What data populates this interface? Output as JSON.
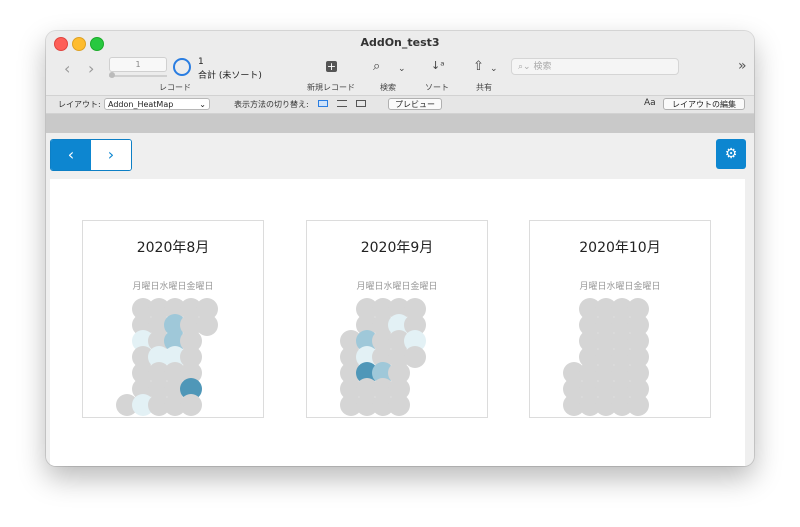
{
  "window": {
    "title": "AddOn_test3"
  },
  "toolbar": {
    "record_field_value": "1",
    "record_count": "1",
    "record_status": "合計 (未ソート)",
    "record_label": "レコード",
    "new_record_label": "新規レコード",
    "find_label": "検索",
    "sort_label": "ソート",
    "share_label": "共有",
    "search_placeholder": "検索"
  },
  "layoutbar": {
    "layout_label": "レイアウト:",
    "layout_value": "Addon_HeatMap",
    "view_switch_label": "表示方法の切り替え:",
    "preview_label": "プレビュー",
    "font_glyph": "Aa",
    "edit_layout_label": "レイアウトの編集"
  },
  "colors": {
    "accent": "#0d86d0",
    "empty": "#d5d5d5",
    "level1": "#e3f1f5",
    "level2": "#9fc8d9",
    "level3": "#4f97b8"
  },
  "cards": [
    {
      "title": "2020年8月",
      "weekdays": "月曜日水曜日金曜日",
      "cells": [
        [
          0,
          6,
          0
        ],
        [
          1,
          0,
          0
        ],
        [
          1,
          1,
          0
        ],
        [
          1,
          2,
          1
        ],
        [
          1,
          3,
          0
        ],
        [
          1,
          4,
          0
        ],
        [
          1,
          5,
          0
        ],
        [
          1,
          6,
          1
        ],
        [
          2,
          0,
          0
        ],
        [
          2,
          1,
          0
        ],
        [
          2,
          2,
          0
        ],
        [
          2,
          3,
          1
        ],
        [
          2,
          4,
          0
        ],
        [
          2,
          5,
          0
        ],
        [
          2,
          6,
          0
        ],
        [
          3,
          0,
          0
        ],
        [
          3,
          1,
          2
        ],
        [
          3,
          2,
          2
        ],
        [
          3,
          3,
          1
        ],
        [
          3,
          4,
          0
        ],
        [
          3,
          5,
          0
        ],
        [
          3,
          6,
          0
        ],
        [
          4,
          0,
          0
        ],
        [
          4,
          1,
          0
        ],
        [
          4,
          2,
          0
        ],
        [
          4,
          3,
          0
        ],
        [
          4,
          4,
          0
        ],
        [
          4,
          5,
          3
        ],
        [
          4,
          6,
          0
        ],
        [
          5,
          0,
          0
        ],
        [
          5,
          1,
          0
        ]
      ]
    },
    {
      "title": "2020年9月",
      "weekdays": "月曜日水曜日金曜日",
      "cells": [
        [
          0,
          2,
          0
        ],
        [
          0,
          3,
          0
        ],
        [
          0,
          4,
          0
        ],
        [
          0,
          5,
          0
        ],
        [
          0,
          6,
          0
        ],
        [
          1,
          0,
          0
        ],
        [
          1,
          1,
          0
        ],
        [
          1,
          2,
          2
        ],
        [
          1,
          3,
          1
        ],
        [
          1,
          4,
          3
        ],
        [
          1,
          5,
          0
        ],
        [
          1,
          6,
          0
        ],
        [
          2,
          0,
          0
        ],
        [
          2,
          1,
          0
        ],
        [
          2,
          2,
          0
        ],
        [
          2,
          3,
          0
        ],
        [
          2,
          4,
          2
        ],
        [
          2,
          5,
          0
        ],
        [
          2,
          6,
          0
        ],
        [
          3,
          0,
          0
        ],
        [
          3,
          1,
          1
        ],
        [
          3,
          2,
          0
        ],
        [
          3,
          3,
          0
        ],
        [
          3,
          4,
          0
        ],
        [
          3,
          5,
          0
        ],
        [
          3,
          6,
          0
        ],
        [
          4,
          0,
          0
        ],
        [
          4,
          1,
          0
        ],
        [
          4,
          2,
          1
        ],
        [
          4,
          3,
          0
        ]
      ]
    },
    {
      "title": "2020年10月",
      "weekdays": "月曜日水曜日金曜日",
      "cells": [
        [
          0,
          4,
          0
        ],
        [
          0,
          5,
          0
        ],
        [
          0,
          6,
          0
        ],
        [
          1,
          0,
          0
        ],
        [
          1,
          1,
          0
        ],
        [
          1,
          2,
          0
        ],
        [
          1,
          3,
          0
        ],
        [
          1,
          4,
          0
        ],
        [
          1,
          5,
          0
        ],
        [
          1,
          6,
          0
        ],
        [
          2,
          0,
          0
        ],
        [
          2,
          1,
          0
        ],
        [
          2,
          2,
          0
        ],
        [
          2,
          3,
          0
        ],
        [
          2,
          4,
          0
        ],
        [
          2,
          5,
          0
        ],
        [
          2,
          6,
          0
        ],
        [
          3,
          0,
          0
        ],
        [
          3,
          1,
          0
        ],
        [
          3,
          2,
          0
        ],
        [
          3,
          3,
          0
        ],
        [
          3,
          4,
          0
        ],
        [
          3,
          5,
          0
        ],
        [
          3,
          6,
          0
        ],
        [
          4,
          0,
          0
        ],
        [
          4,
          1,
          0
        ],
        [
          4,
          2,
          0
        ],
        [
          4,
          3,
          0
        ],
        [
          4,
          4,
          0
        ],
        [
          4,
          5,
          0
        ],
        [
          4,
          6,
          0
        ]
      ]
    }
  ]
}
